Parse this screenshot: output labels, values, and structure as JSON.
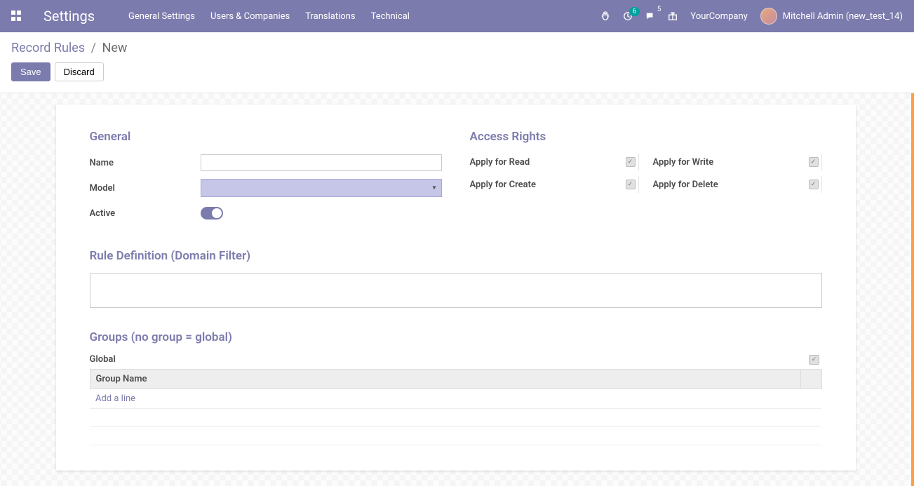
{
  "navbar": {
    "brand": "Settings",
    "menu": [
      "General Settings",
      "Users & Companies",
      "Translations",
      "Technical"
    ],
    "badge_activities": "6",
    "badge_messages": "5",
    "company": "YourCompany",
    "username": "Mitchell Admin (new_test_14)"
  },
  "breadcrumb": {
    "parent": "Record Rules",
    "sep": "/",
    "current": "New"
  },
  "actions": {
    "save": "Save",
    "discard": "Discard"
  },
  "sections": {
    "general": "General",
    "access": "Access Rights",
    "rule_def": "Rule Definition (Domain Filter)",
    "groups": "Groups (no group = global)"
  },
  "general_fields": {
    "name_label": "Name",
    "name_value": "",
    "model_label": "Model",
    "model_value": "",
    "active_label": "Active"
  },
  "access_fields": {
    "read": "Apply for Read",
    "write": "Apply for Write",
    "create": "Apply for Create",
    "delete": "Apply for Delete",
    "check": "✓"
  },
  "domain_value": "",
  "groups": {
    "global_label": "Global",
    "col_name": "Group Name",
    "add_line": "Add a line"
  }
}
